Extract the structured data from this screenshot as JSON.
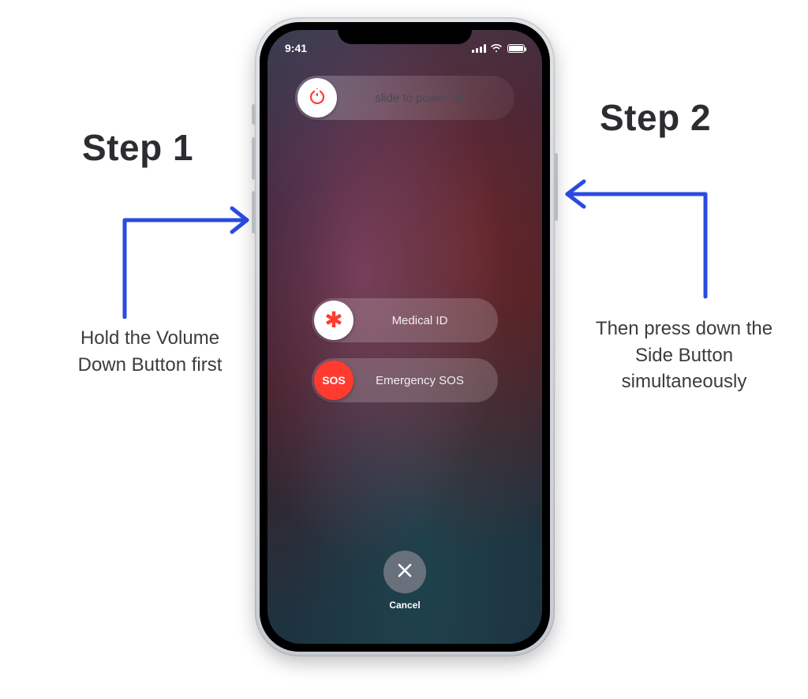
{
  "status": {
    "time": "9:41"
  },
  "sliders": {
    "power": {
      "label": "slide to power off",
      "knob_icon": "power-icon"
    },
    "medical": {
      "label": "Medical ID",
      "knob_icon": "asterisk-icon"
    },
    "sos": {
      "label": "Emergency SOS",
      "knob_text": "SOS"
    }
  },
  "cancel": {
    "label": "Cancel"
  },
  "annotations": {
    "step1": {
      "title": "Step 1",
      "desc": "Hold the Volume Down Button first"
    },
    "step2": {
      "title": "Step 2",
      "desc": "Then press down the Side Button simultaneously"
    }
  }
}
